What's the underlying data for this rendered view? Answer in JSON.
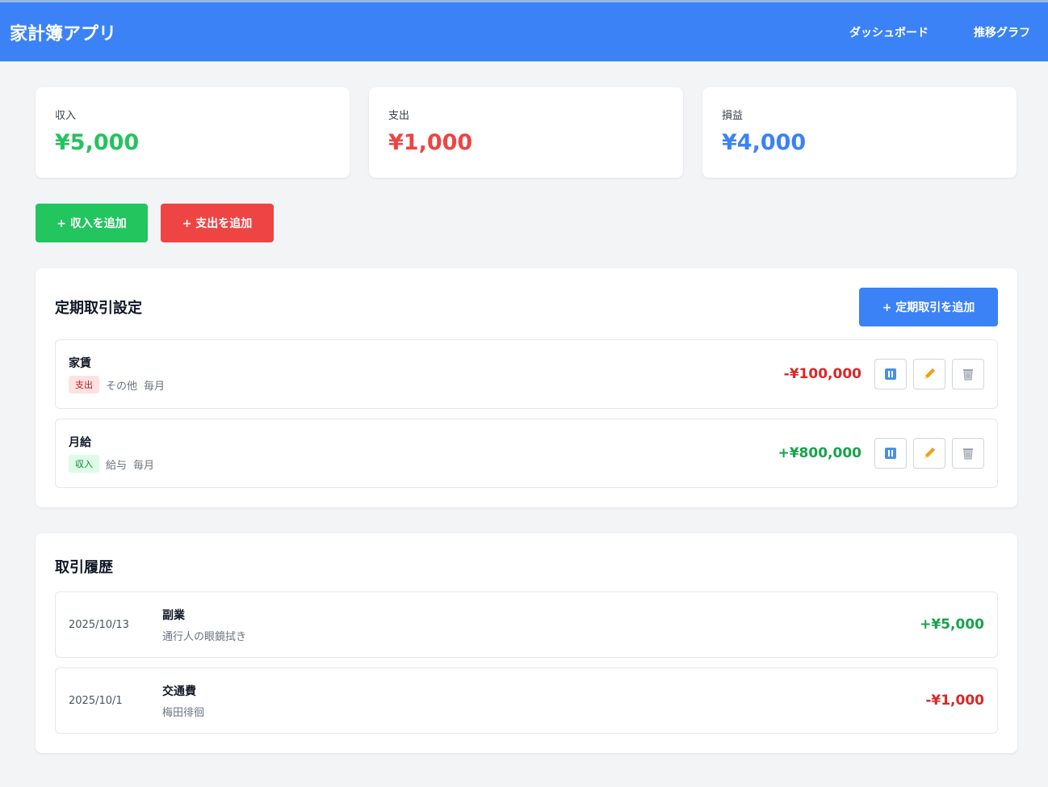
{
  "app": {
    "title": "家計簿アプリ"
  },
  "nav": {
    "dashboard": "ダッシュボード",
    "trend": "推移グラフ"
  },
  "summary": {
    "income": {
      "label": "収入",
      "value": "¥5,000"
    },
    "expense": {
      "label": "支出",
      "value": "¥1,000"
    },
    "profit": {
      "label": "損益",
      "value": "¥4,000"
    }
  },
  "actions": {
    "add_income": "+ 収入を追加",
    "add_expense": "+ 支出を追加"
  },
  "recurring": {
    "title": "定期取引設定",
    "add_label": "+ 定期取引を追加",
    "items": [
      {
        "name": "家賃",
        "type": "支出",
        "category": "その他",
        "frequency": "毎月",
        "amount": "-¥100,000"
      },
      {
        "name": "月給",
        "type": "収入",
        "category": "給与",
        "frequency": "毎月",
        "amount": "+¥800,000"
      }
    ]
  },
  "history": {
    "title": "取引履歴",
    "items": [
      {
        "date": "2025/10/13",
        "category": "副業",
        "memo": "通行人の眼鏡拭き",
        "amount": "+¥5,000"
      },
      {
        "date": "2025/10/1",
        "category": "交通費",
        "memo": "梅田徘徊",
        "amount": "-¥1,000"
      }
    ]
  },
  "colors": {
    "accent": "#3b82f6",
    "income": "#22c55e",
    "expense": "#ef4444"
  },
  "icons": {
    "pause": "pause-icon",
    "edit": "pencil-icon",
    "delete": "trash-icon"
  }
}
